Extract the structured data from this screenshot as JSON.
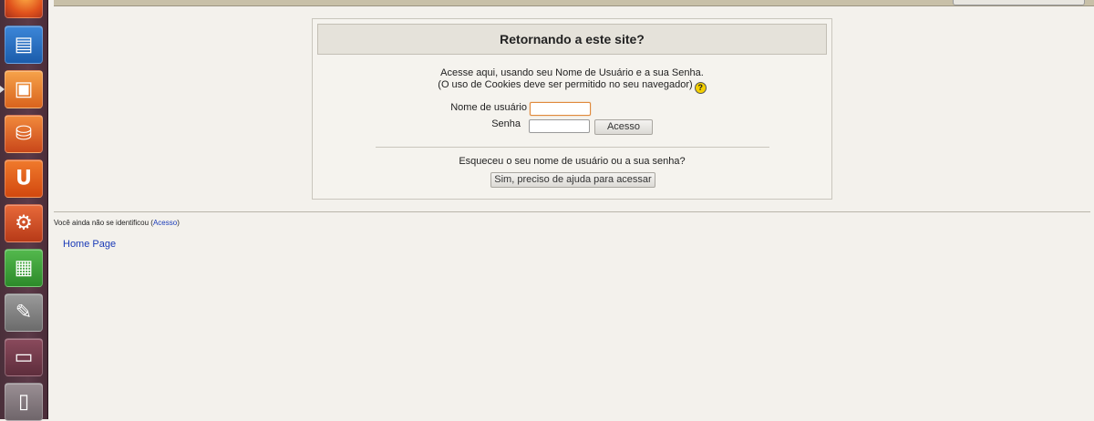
{
  "launcher": {
    "items": [
      {
        "name": "firefox-icon",
        "glyph": ""
      },
      {
        "name": "writer-icon",
        "glyph": "▤"
      },
      {
        "name": "impress-icon",
        "glyph": "▣"
      },
      {
        "name": "software-center-icon",
        "glyph": "⛁"
      },
      {
        "name": "ubuntu-one-icon",
        "glyph": "U"
      },
      {
        "name": "system-settings-icon",
        "glyph": "⚙"
      },
      {
        "name": "calc-icon",
        "glyph": "▦"
      },
      {
        "name": "text-editor-icon",
        "glyph": "✎"
      },
      {
        "name": "workspace-switcher-icon",
        "glyph": "▭"
      },
      {
        "name": "media-player-icon",
        "glyph": "▯"
      }
    ]
  },
  "login": {
    "title": "Retornando a este site?",
    "intro_line1": "Acesse aqui, usando seu Nome de Usuário e a sua Senha.",
    "intro_line2": "(O uso de Cookies deve ser permitido no seu navegador)",
    "help_glyph": "?",
    "username_label": "Nome de usuário",
    "password_label": "Senha",
    "username_value": "",
    "password_value": "",
    "submit_label": "Acesso",
    "forgot_text": "Esqueceu o seu nome de usuário ou a sua senha?",
    "forgot_button": "Sim, preciso de ajuda para acessar"
  },
  "footer": {
    "logininfo_prefix": "Você ainda não se identificou (",
    "logininfo_link": "Acesso",
    "logininfo_suffix": ")",
    "home_link": "Home Page"
  },
  "colors": {
    "launcher_bg": "#5c3a48",
    "link": "#1a3bb8",
    "header_bg": "#e5e2da",
    "focus": "#e08a3c"
  }
}
